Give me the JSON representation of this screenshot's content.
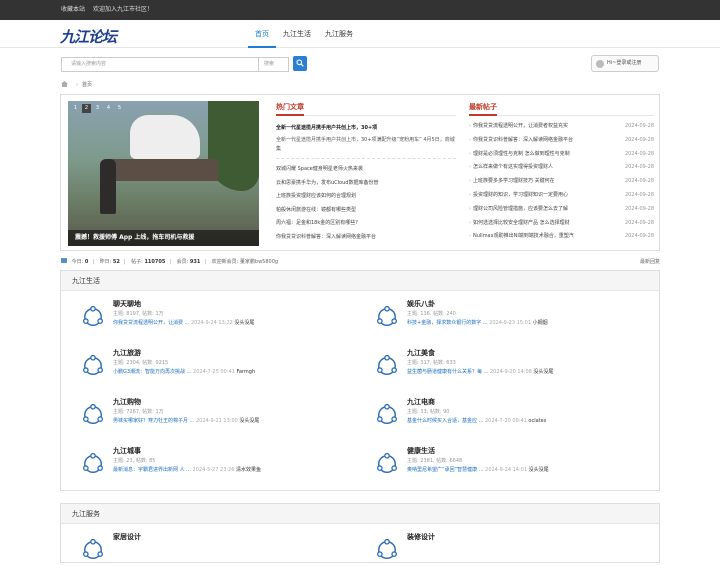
{
  "topbar": {
    "bookmark": "收藏本站",
    "welcome": "欢迎加入九江市社区！"
  },
  "logo": "九江论坛",
  "nav": [
    {
      "label": "首页",
      "active": true
    },
    {
      "label": "九江生活",
      "active": false
    },
    {
      "label": "九江服务",
      "active": false
    }
  ],
  "search": {
    "placeholder": "请输入搜索内容",
    "type": "搜索"
  },
  "login": "Hi~登录或注册",
  "breadcrumb": {
    "current": "首页"
  },
  "slider": {
    "pages": [
      "1",
      "2",
      "3",
      "4",
      "5"
    ],
    "caption": "震撼！救援师傅 App 上线，拖车司机与救援"
  },
  "hot": {
    "title": "热门文章",
    "lead": "全新一代星途揽月携手用户共创上市，30+项",
    "sub": "全新一代星途揽月携手用户共创上市，30+项满配升级“宠粉用车” 4月5日，商城集",
    "items": [
      "双城闪耀 Space健身明星老师火热来袭",
      "云和思豪携手华为，发布uCloud数据库备份管",
      "上班族投资理财应该如何的合理规划",
      "帕般休闲旅游在线：镜都有哪些类型",
      "周六福：足金和18k金的区别有哪些?",
      "你我贷贷识科普解答：深入解读网络金融平台"
    ]
  },
  "latest": {
    "title": "最新帖子",
    "items": [
      {
        "text": "你我贷贷流程透明公开，让消费者权益充实",
        "date": "2024-09-28"
      },
      {
        "text": "你我贷贷识科普解答：深入解读网络金融平台",
        "date": "2024-09-28"
      },
      {
        "text": "理财是必须理性与克制 怎么做到理性与克制",
        "date": "2024-09-28"
      },
      {
        "text": "怎么样来做个有这实理得投资理财人",
        "date": "2024-09-28"
      },
      {
        "text": "上班族要多多学习理财技巧 关键何在",
        "date": "2024-09-28"
      },
      {
        "text": "投资理财的知识，学习理财知识一定要用心",
        "date": "2024-09-28"
      },
      {
        "text": "理财公司风险管理措施，应该要怎么去了解",
        "date": "2024-09-28"
      },
      {
        "text": "如何选选择比较安全理财产品 怎么选择理财",
        "date": "2024-09-28"
      },
      {
        "text": "Nullmax观助推出NI端到端技术融合，重塑汽",
        "date": "2024-09-28"
      }
    ]
  },
  "stats": {
    "today_label": "今日:",
    "today": "0",
    "yesterday_label": "昨日:",
    "yesterday": "52",
    "posts_label": "帖子:",
    "posts": "110705",
    "members_label": "会员:",
    "members": "931",
    "newest_label": "欢迎新会员:",
    "newest": "董家鹏bw5800g",
    "latest_replies": "最新回复"
  },
  "sections": [
    {
      "title": "九江生活",
      "boards": [
        {
          "name": "聊天聊地",
          "stats": "主题: 8197, 帖数: 1万",
          "last_title": "你我贷贷流程透明公开，让消费 ...",
          "last_meta": "2024-9-24 13:22",
          "last_user": "没头没尾"
        },
        {
          "name": "娱乐八卦",
          "stats": "主题: 136, 帖数: 240",
          "last_title": "科技+金融，择求数众银行的数字 ...",
          "last_meta": "2024-9-23 15:01",
          "last_user": "小钢烟"
        },
        {
          "name": "九江旅游",
          "stats": "主题: 2304, 帖数: 9215",
          "last_title": "小鹏G3潮流：智能万向再次挑战 ...",
          "last_meta": "2024-7-25 00:41",
          "last_user": "Farmgh"
        },
        {
          "name": "九江美食",
          "stats": "主题: 317, 帖数: 633",
          "last_title": "益生菌与肠道健康有什么关系？每 ...",
          "last_meta": "2024-9-20 14:08",
          "last_user": "没头没尾"
        },
        {
          "name": "九江购物",
          "stats": "主题: 7267, 帖数: 1万",
          "last_title": "男袜买哪家好？穿力牡王的棉子月 ...",
          "last_meta": "2024-9-21 13:00",
          "last_user": "没头没尾"
        },
        {
          "name": "九江电商",
          "stats": "主题: 33, 帖数: 90",
          "last_title": "基金什么时候买入合适，基金应 ...",
          "last_meta": "2024-7-20 09:41",
          "last_user": "oclates"
        },
        {
          "name": "九江城事",
          "stats": "主题: 23, 帖数: 85",
          "last_title": "最新消息：宇霸君进界出新网 人 ...",
          "last_meta": "2024-5-27 23:26",
          "last_user": "清水效果鱼"
        },
        {
          "name": "健康生活",
          "stats": "主题: 2381, 帖数: 6648",
          "last_title": "奥呐里尼希望广“承回”智慧健康 ...",
          "last_meta": "2024-9-24 14:01",
          "last_user": "没头没尾"
        }
      ]
    },
    {
      "title": "九江服务",
      "boards": [
        {
          "name": "家居设计",
          "stats": "",
          "last_title": "",
          "last_meta": "",
          "last_user": ""
        },
        {
          "name": "装修设计",
          "stats": "",
          "last_title": "",
          "last_meta": "",
          "last_user": ""
        }
      ]
    }
  ]
}
